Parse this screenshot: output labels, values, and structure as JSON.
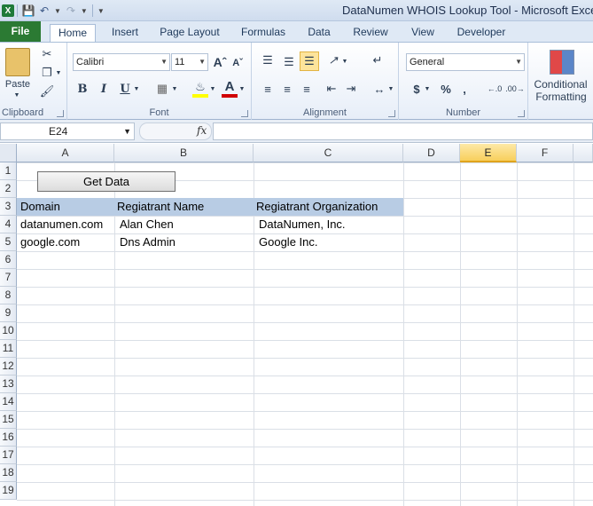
{
  "window": {
    "title": "DataNumen WHOIS Lookup Tool  -  Microsoft Excel"
  },
  "tabs": [
    "File",
    "Home",
    "Insert",
    "Page Layout",
    "Formulas",
    "Data",
    "Review",
    "View",
    "Developer"
  ],
  "active_tab": "Home",
  "ribbon": {
    "clipboard": {
      "paste_label": "Paste",
      "group_label": "Clipboard"
    },
    "font": {
      "family": "Calibri",
      "size": "11",
      "group_label": "Font",
      "bold": "B",
      "italic": "I",
      "underline": "U"
    },
    "alignment": {
      "group_label": "Alignment"
    },
    "number": {
      "format": "General",
      "group_label": "Number",
      "currency": "$",
      "percent": "%",
      "comma": ","
    },
    "styles": {
      "conditional_line1": "Conditional",
      "conditional_line2": "Formatting"
    }
  },
  "formula_bar": {
    "name_box": "E24",
    "fx": "fx",
    "value": ""
  },
  "columns": [
    "A",
    "B",
    "C",
    "D",
    "E",
    "F"
  ],
  "selected_column": "E",
  "rows": [
    "1",
    "2",
    "3",
    "4",
    "5",
    "6",
    "7",
    "8",
    "9",
    "10",
    "11",
    "12",
    "13",
    "14",
    "15",
    "16",
    "17",
    "18",
    "19"
  ],
  "button": {
    "label": "Get Data"
  },
  "table": {
    "headers": [
      "Domain",
      "Regiatrant Name",
      "Regiatrant Organization"
    ],
    "rows": [
      [
        "datanumen.com",
        "Alan Chen",
        "DataNumen, Inc."
      ],
      [
        "google.com",
        "Dns Admin",
        "Google Inc."
      ]
    ]
  },
  "colors": {
    "header_fill": "#b8cce4",
    "file_tab": "#2b7a33",
    "selected_col": "#f8cf5c"
  }
}
